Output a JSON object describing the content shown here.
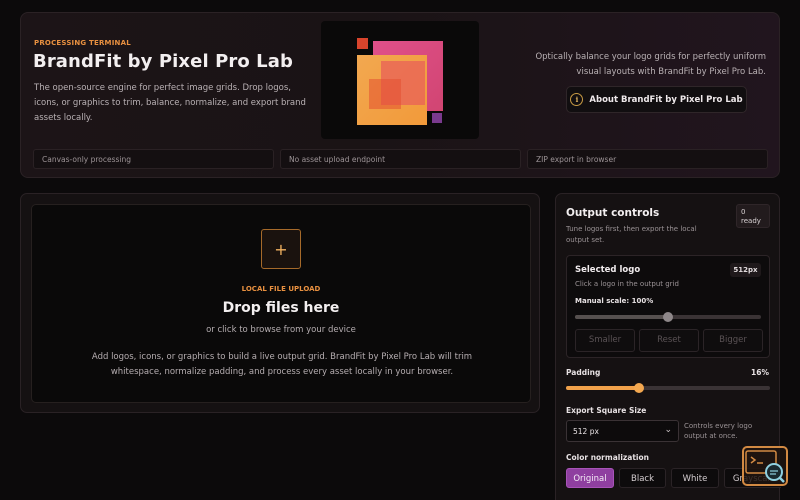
{
  "hero": {
    "eyebrow": "PROCESSING TERMINAL",
    "title": "BrandFit by Pixel Pro Lab",
    "description": "The open-source engine for perfect image grids. Drop logos, icons, or graphics to trim, balance, normalize, and export brand assets locally.",
    "tagline": "Optically balance your logo grids for perfectly uniform visual layouts with BrandFit by Pixel Pro Lab.",
    "about_button": "About BrandFit by Pixel Pro Lab",
    "chips": [
      "Canvas-only processing",
      "No asset upload endpoint",
      "ZIP export in browser"
    ]
  },
  "upload": {
    "eyebrow": "LOCAL FILE UPLOAD",
    "title": "Drop files here",
    "subtitle": "or click to browse from your device",
    "description": "Add logos, icons, or graphics to build a live output grid. BrandFit by Pixel Pro Lab will trim whitespace, normalize padding, and process every asset locally in your browser.",
    "plus_symbol": "+"
  },
  "controls": {
    "title": "Output controls",
    "subtitle": "Tune logos first, then export the local output set.",
    "ready_count": "0",
    "ready_label": "ready",
    "selected_logo": {
      "title": "Selected logo",
      "size_badge": "512px",
      "hint": "Click a logo in the output grid",
      "scale_label": "Manual scale: 100%",
      "scale_fraction": 0.5,
      "buttons": [
        "Smaller",
        "Reset",
        "Bigger"
      ]
    },
    "padding": {
      "label": "Padding",
      "value_text": "16%",
      "fraction": 0.36
    },
    "export_size": {
      "label": "Export Square Size",
      "selected": "512 px",
      "note": "Controls every logo output at once."
    },
    "color_normalization": {
      "label": "Color normalization",
      "options": [
        "Original",
        "Black",
        "White",
        "Grayscale"
      ],
      "active": "Original"
    }
  },
  "colors": {
    "accent_orange": "#e89040",
    "accent_purple": "#8f3fa0",
    "slider_orange": "#f0a14a"
  },
  "icons": {
    "info": "info-icon",
    "plus": "plus-icon",
    "chevron": "chevron-down-icon",
    "terminal": "terminal-search-icon"
  }
}
